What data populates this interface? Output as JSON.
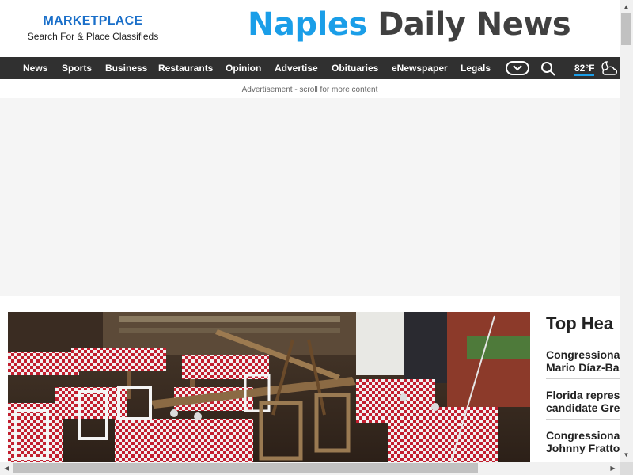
{
  "marketplace": {
    "title": "MARKETPLACE",
    "subtitle": "Search For & Place Classifieds"
  },
  "logo": {
    "part1": "Naples",
    "part2": "Daily News"
  },
  "nav": {
    "items": [
      "News",
      "Sports",
      "Business",
      "Restaurants",
      "Opinion",
      "Advertise",
      "Obituaries",
      "eNewspaper",
      "Legals"
    ],
    "weather_temp": "82°F"
  },
  "ad": {
    "label": "Advertisement - scroll for more content"
  },
  "headlines": {
    "title": "Top Hea",
    "items": [
      {
        "line1": "Congressional",
        "line2": "Mario Díaz-Ba"
      },
      {
        "line1": "Florida repres",
        "line2": "candidate Gre"
      },
      {
        "line1": "Congressional",
        "line2": "Johnny Fratto"
      }
    ]
  },
  "colors": {
    "brand_blue": "#1a9ee8",
    "logo_gray": "#404040",
    "nav_bg": "#303030",
    "marketplace_blue": "#1a6fc9"
  }
}
